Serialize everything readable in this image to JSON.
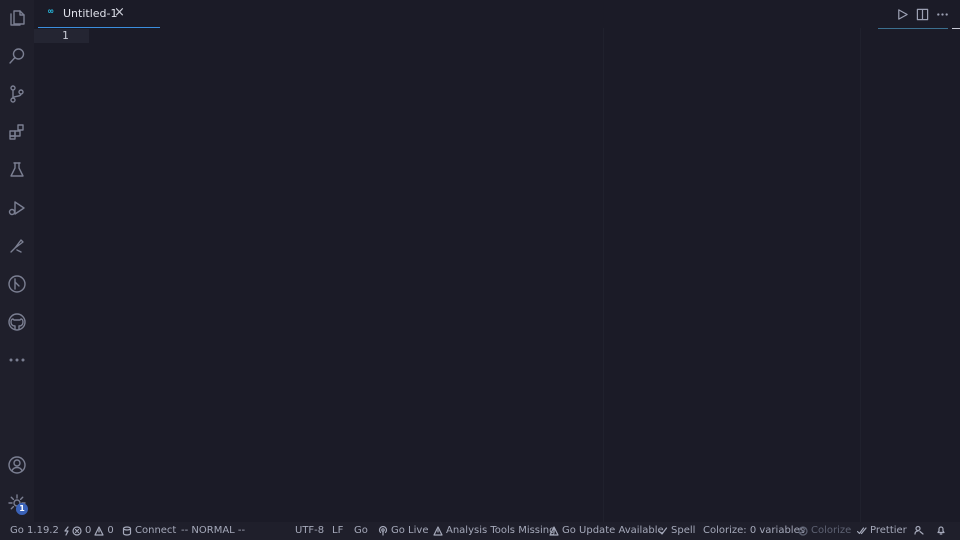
{
  "activity_bar": {
    "icons": [
      "files-icon",
      "search-icon",
      "source-control-icon",
      "extensions-icon",
      "testing-icon",
      "run-debug-icon",
      "remote-explorer-icon",
      "gitlens-icon",
      "github-icon",
      "more-icon",
      "account-icon",
      "settings-gear-icon"
    ],
    "settings_badge": "1"
  },
  "tabs": [
    {
      "lang_icon": "GO",
      "title": "Untitled-1",
      "close": "×"
    }
  ],
  "editor": {
    "line_numbers": [
      "1"
    ]
  },
  "status_bar": {
    "go_version": "Go 1.19.2",
    "errors": "0",
    "warnings": "0",
    "connect": "Connect",
    "vim_mode": "-- NORMAL --",
    "encoding": "UTF-8",
    "eol": "LF",
    "language": "Go",
    "go_live": "Go Live",
    "analysis_tools": "Analysis Tools Missing",
    "go_update": "Go Update Available",
    "spell": "Spell",
    "colorize_vars": "Colorize: 0 variables",
    "colorize": "Colorize",
    "prettier": "Prettier"
  },
  "colors": {
    "accent": "#3b8ede",
    "go_blue": "#27b3d7",
    "background": "#1b1b27"
  }
}
